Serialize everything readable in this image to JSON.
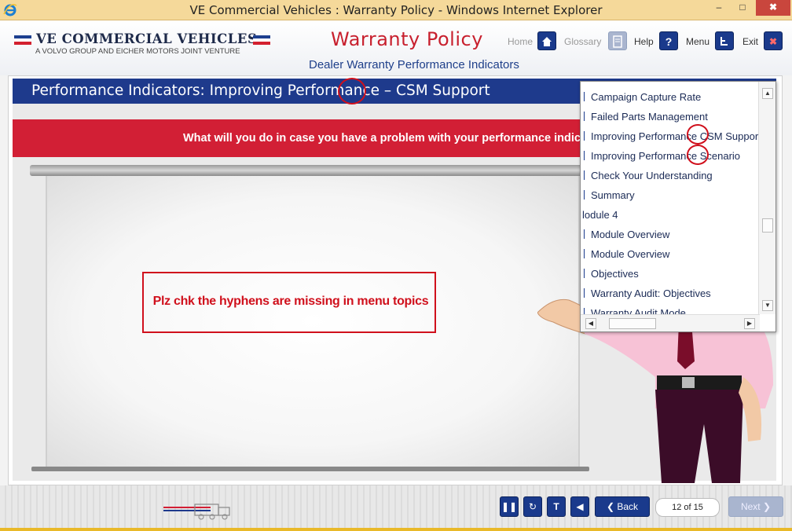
{
  "window": {
    "title": "VE Commercial Vehicles : Warranty Policy - Windows Internet Explorer",
    "controls": {
      "minimize": "–",
      "maximize": "□",
      "close": "✖"
    }
  },
  "header": {
    "brand": "VE COMMERCIAL VEHICLES",
    "brand_sub": "A VOLVO GROUP AND EICHER MOTORS JOINT VENTURE",
    "course_title": "Warranty Policy",
    "course_subtitle": "Dealer Warranty Performance Indicators",
    "nav": {
      "home": "Home",
      "glossary": "Glossary",
      "help": "Help",
      "help_icon": "?",
      "menu": "Menu",
      "exit": "Exit",
      "exit_icon": "✖"
    }
  },
  "page": {
    "title": "Performance Indicators: Improving Performance – CSM Support",
    "question": "What will you do in case you have a problem with your performance indicat",
    "review_note": "Plz chk the hyphens are missing in menu topics"
  },
  "menu": {
    "items": [
      {
        "label": "Campaign Capture Rate",
        "bar": true
      },
      {
        "label": "Failed Parts Management",
        "bar": true
      },
      {
        "label": "Improving Performance  CSM Suppor",
        "bar": true
      },
      {
        "label": "Improving Performance  Scenario",
        "bar": true
      },
      {
        "label": "Check Your Understanding",
        "bar": true
      },
      {
        "label": "Summary",
        "bar": true
      },
      {
        "label": "lodule 4",
        "bar": false
      },
      {
        "label": "Module Overview",
        "bar": true
      },
      {
        "label": "Module Overview",
        "bar": true
      },
      {
        "label": "Objectives",
        "bar": true
      },
      {
        "label": "Warranty Audit: Objectives",
        "bar": true
      },
      {
        "label": "Warranty Audit Mode",
        "bar": true
      }
    ]
  },
  "footer": {
    "pause": "❚❚",
    "replay": "↻",
    "transcript": "T",
    "audio": "◀",
    "back": "Back",
    "back_icon": "❮",
    "page_indicator": "12 of 15",
    "next": "Next",
    "next_icon": "❯"
  },
  "colors": {
    "brand_blue": "#1e3a8c",
    "brand_red": "#d21f35",
    "annotation_red": "#d0101c"
  }
}
